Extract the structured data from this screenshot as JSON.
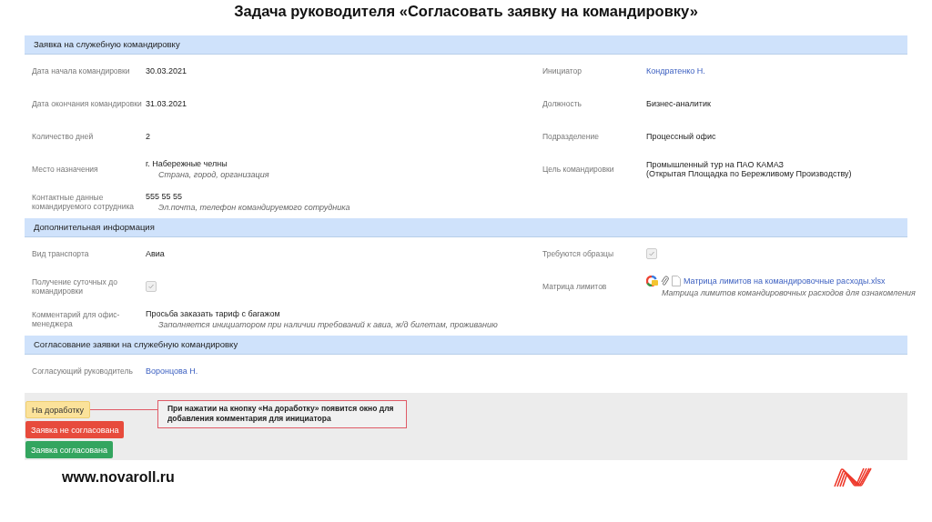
{
  "title": "Задача руководителя «Согласовать заявку на командировку»",
  "sections": [
    {
      "heading": "Заявка на служебную командировку",
      "rows": [
        {
          "left": {
            "label": "Дата начала командировки",
            "kind": "text",
            "value": "30.03.2021"
          },
          "right": {
            "label": "Инициатор",
            "kind": "link",
            "value": "Кондратенко Н."
          }
        },
        {
          "left": {
            "label": "Дата окончания командировки",
            "kind": "text",
            "value": "31.03.2021"
          },
          "right": {
            "label": "Должность",
            "kind": "text",
            "value": "Бизнес-аналитик"
          }
        },
        {
          "left": {
            "label": "Количество дней",
            "kind": "text",
            "value": "2"
          },
          "right": {
            "label": "Подразделение",
            "kind": "text",
            "value": "Процессный офис"
          }
        },
        {
          "left": {
            "label": "Место назначения",
            "kind": "text",
            "value": "г. Набережные челны",
            "hint": "Страна, город, организация"
          },
          "right": {
            "label": "Цель командировки",
            "kind": "text",
            "value": "Промышленный тур на ПАО КАМАЗ\n(Открытая Площадка по Бережливому Производству)"
          }
        },
        {
          "left": {
            "label": "Контактные данные командируемого сотрудника",
            "kind": "text",
            "value": "555 55 55",
            "hint": "Эл.почта, телефон командируемого сотрудника"
          }
        }
      ]
    },
    {
      "heading": "Дополнительная информация",
      "rows": [
        {
          "left": {
            "label": "Вид транспорта",
            "kind": "text",
            "value": "Авиа"
          },
          "right": {
            "label": "Требуются образцы",
            "kind": "checkbox",
            "checked": true
          }
        },
        {
          "left": {
            "label": "Получение суточных до командировки",
            "kind": "checkbox",
            "checked": true
          },
          "right": {
            "label": "Матрица лимитов",
            "kind": "file",
            "value": "Матрица лимитов на командировочные расходы.xlsx",
            "hint": "Матрица лимитов командировочных расходов для ознакомления"
          }
        },
        {
          "left": {
            "label": "Комментарий для офис-менеджера",
            "kind": "text",
            "value": "Просьба заказать тариф с багажом",
            "hint": "Заполняется инициатором при наличии требований к авиа, ж/д билетам, проживанию"
          }
        }
      ]
    },
    {
      "heading": "Согласование заявки на служебную командировку",
      "rows": [
        {
          "left": {
            "label": "Согласующий руководитель",
            "kind": "link",
            "value": "Воронцова Н."
          }
        }
      ]
    }
  ],
  "actions": [
    {
      "label": "На доработку",
      "kind": "warning",
      "callout": "При нажатии на кнопку «На доработку» появится окно для добавления комментария для инициатора"
    },
    {
      "label": "Заявка не согласована",
      "kind": "danger"
    },
    {
      "label": "Заявка согласована",
      "kind": "success"
    }
  ],
  "footer": {
    "url": "www.novaroll.ru"
  }
}
